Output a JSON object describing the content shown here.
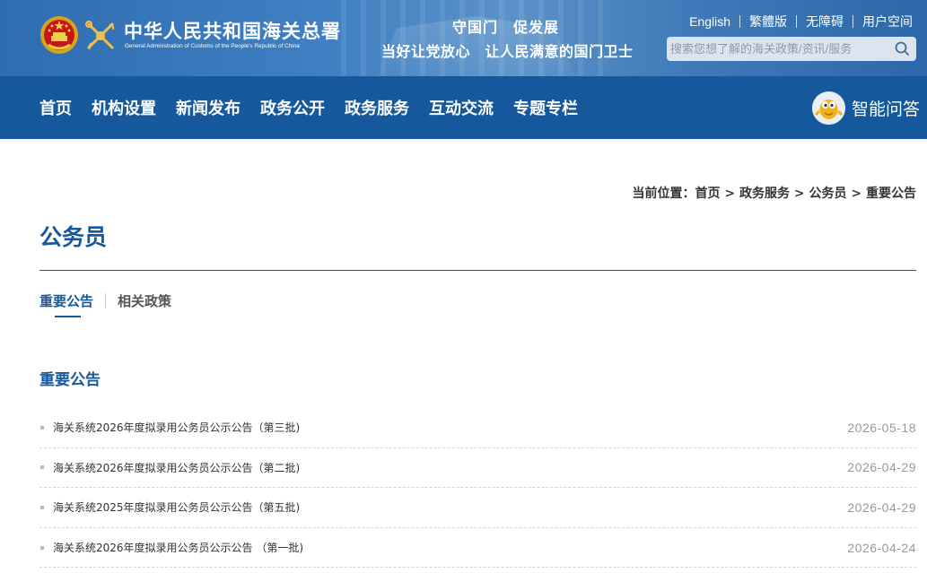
{
  "header": {
    "title": "中华人民共和国海关总署",
    "subtitle": "General Administration of Customs of the People's Republic of China",
    "slogan_line1": "守国门　促发展",
    "slogan_line2": "当好让党放心　让人民满意的国门卫士",
    "links": [
      "English",
      "繁體版",
      "无障碍",
      "用户空间"
    ],
    "search_placeholder": "搜索您想了解的海关政策/资讯/服务",
    "colors": {
      "header_blue": "#3f7fc2",
      "nav_blue": "#15589c"
    }
  },
  "nav": {
    "items": [
      "首页",
      "机构设置",
      "新闻发布",
      "政务公开",
      "政务服务",
      "互动交流",
      "专题专栏"
    ],
    "ai_label": "智能问答"
  },
  "breadcrumb": {
    "prefix": "当前位置：",
    "items": [
      "首页",
      "政务服务",
      "公务员",
      "重要公告"
    ],
    "separator": " > "
  },
  "page": {
    "title": "公务员",
    "tabs": [
      "重要公告",
      "相关政策"
    ],
    "active_tab": "重要公告",
    "section_heading": "重要公告"
  },
  "news": [
    {
      "title": "海关系统2026年度拟录用公务员公示公告（第三批)",
      "date": "2026-05-18"
    },
    {
      "title": "海关系统2026年度拟录用公务员公示公告（第二批)",
      "date": "2026-04-29"
    },
    {
      "title": "海关系统2025年度拟录用公务员公示公告（第五批)",
      "date": "2026-04-29"
    },
    {
      "title": "海关系统2026年度拟录用公务员公示公告 （第一批)",
      "date": "2026-04-24"
    }
  ]
}
